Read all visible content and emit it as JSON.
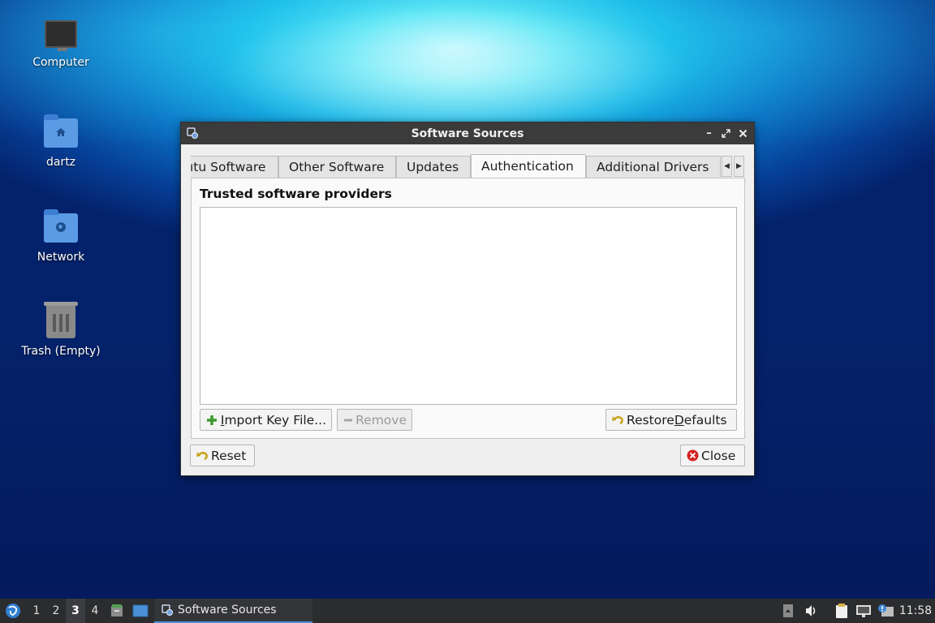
{
  "desktop": {
    "icons": [
      {
        "label": "Computer",
        "icon": "monitor-icon"
      },
      {
        "label": "dartz",
        "icon": "home-folder-icon"
      },
      {
        "label": "Network",
        "icon": "network-folder-icon"
      },
      {
        "label": "Trash (Empty)",
        "icon": "trash-icon"
      }
    ]
  },
  "window": {
    "title": "Software Sources",
    "controls": [
      "minimize-icon",
      "maximize-icon",
      "close-icon"
    ],
    "tabs": [
      {
        "label": "ıtu Software",
        "active": false
      },
      {
        "label": "Other Software",
        "active": false
      },
      {
        "label": "Updates",
        "active": false
      },
      {
        "label": "Authentication",
        "active": true
      },
      {
        "label": "Additional Drivers",
        "active": false
      }
    ],
    "authentication": {
      "heading": "Trusted software providers",
      "import_prefix": "",
      "import_underline": "I",
      "import_rest": "mport Key File...",
      "remove_label": "Remove",
      "restore_prefix": "Restore ",
      "restore_underline": "D",
      "restore_rest": "efaults"
    },
    "footer": {
      "reset_label": "Reset",
      "close_label": "Close"
    }
  },
  "taskbar": {
    "workspaces": [
      "1",
      "2",
      "3",
      "4"
    ],
    "current_workspace": "3",
    "task_label": "Software Sources",
    "clock": "11:58"
  }
}
